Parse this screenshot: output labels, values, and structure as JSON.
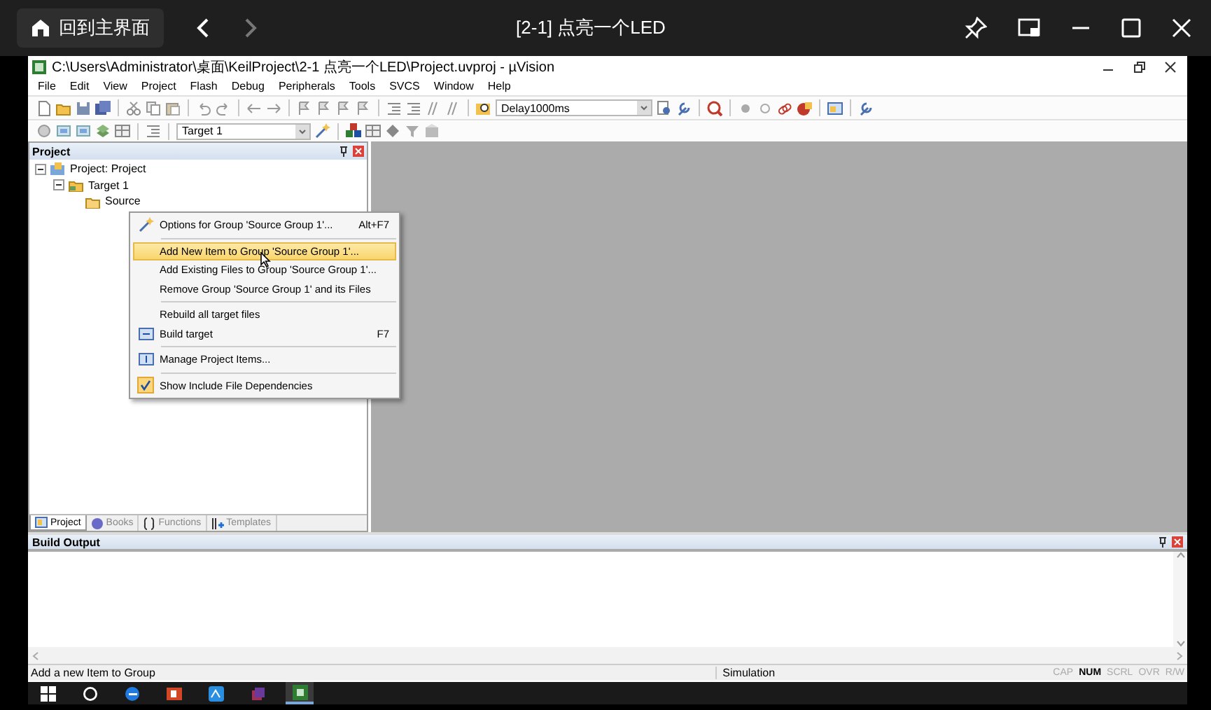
{
  "top_bar": {
    "home_button": "回到主界面",
    "title": "[2-1] 点亮一个LED"
  },
  "window": {
    "title": "C:\\Users\\Administrator\\桌面\\KeilProject\\2-1 点亮一个LED\\Project.uvproj - µVision"
  },
  "menu_bar": [
    "File",
    "Edit",
    "View",
    "Project",
    "Flash",
    "Debug",
    "Peripherals",
    "Tools",
    "SVCS",
    "Window",
    "Help"
  ],
  "toolbar": {
    "find_combo": "Delay1000ms",
    "target_combo": "Target 1"
  },
  "project_panel": {
    "title": "Project",
    "tree": [
      {
        "label": "Project: Project",
        "expanded": true,
        "children": [
          {
            "label": "Target 1",
            "expanded": true,
            "children": [
              {
                "label": "Source"
              }
            ]
          }
        ]
      }
    ],
    "tabs": [
      {
        "label": "Project",
        "selected": true
      },
      {
        "label": "Books",
        "selected": false
      },
      {
        "label": "Functions",
        "selected": false
      },
      {
        "label": "Templates",
        "selected": false
      }
    ]
  },
  "context_menu": {
    "items": [
      {
        "kind": "item",
        "label": "Options for Group 'Source Group 1'...",
        "shortcut": "Alt+F7",
        "selected": false,
        "checked": false
      },
      {
        "kind": "separator"
      },
      {
        "kind": "item",
        "label": "Add New  Item to Group 'Source Group 1'...",
        "selected": true,
        "checked": false
      },
      {
        "kind": "item",
        "label": "Add Existing Files to Group 'Source Group 1'...",
        "selected": false,
        "checked": false
      },
      {
        "kind": "item",
        "label": "Remove Group 'Source Group 1' and its Files",
        "selected": false,
        "checked": false
      },
      {
        "kind": "separator"
      },
      {
        "kind": "item",
        "label": "Rebuild all target files",
        "selected": false,
        "checked": false
      },
      {
        "kind": "item",
        "label": "Build target",
        "shortcut": "F7",
        "selected": false,
        "checked": false
      },
      {
        "kind": "separator"
      },
      {
        "kind": "item",
        "label": "Manage Project Items...",
        "selected": false,
        "checked": false
      },
      {
        "kind": "separator"
      },
      {
        "kind": "item",
        "label": "Show Include File Dependencies",
        "selected": false,
        "checked": true
      }
    ]
  },
  "build_output": {
    "title": "Build Output"
  },
  "status_bar": {
    "message": "Add a new Item to Group",
    "mode": "Simulation",
    "indicators": [
      {
        "label": "CAP",
        "on": false
      },
      {
        "label": "NUM",
        "on": true
      },
      {
        "label": "SCRL",
        "on": false
      },
      {
        "label": "OVR",
        "on": false
      },
      {
        "label": "R/W",
        "on": false
      }
    ]
  }
}
